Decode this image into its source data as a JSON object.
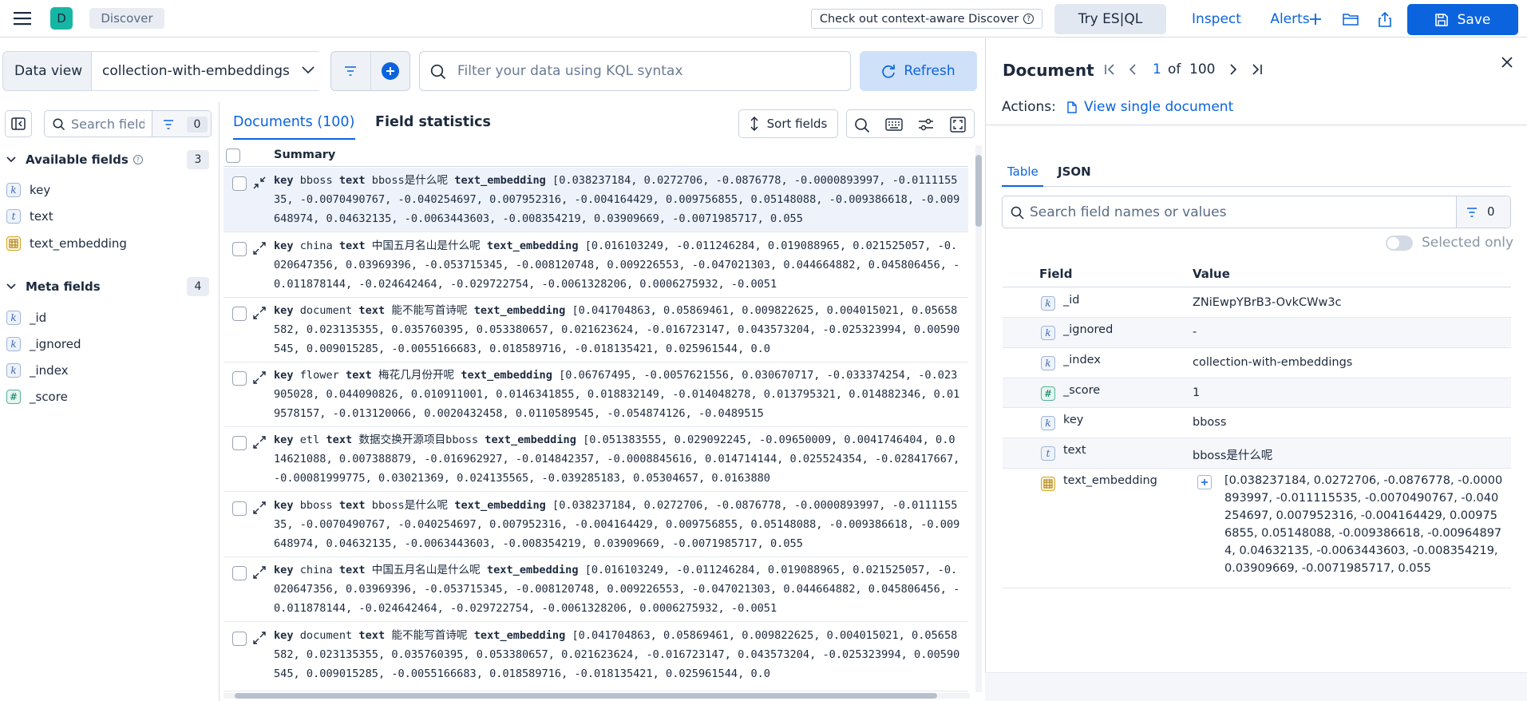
{
  "header": {
    "app_initial": "D",
    "breadcrumb": "Discover",
    "context_aware": "Check out context-aware Discover",
    "try_esql": "Try ES|QL",
    "inspect": "Inspect",
    "alerts": "Alerts",
    "save": "Save"
  },
  "query_bar": {
    "data_view_label": "Data view",
    "data_view_value": "collection-with-embeddings",
    "search_placeholder": "Filter your data using KQL syntax",
    "refresh": "Refresh"
  },
  "sidebar": {
    "search_placeholder": "Search field names",
    "filter_count": "0",
    "available_title": "Available fields",
    "available_count": "3",
    "available_fields": [
      {
        "type": "k",
        "name": "key"
      },
      {
        "type": "t",
        "name": "text"
      },
      {
        "type": "vector",
        "name": "text_embedding"
      }
    ],
    "meta_title": "Meta fields",
    "meta_count": "4",
    "meta_fields": [
      {
        "type": "k",
        "name": "_id"
      },
      {
        "type": "k",
        "name": "_ignored"
      },
      {
        "type": "k",
        "name": "_index"
      },
      {
        "type": "#",
        "name": "_score"
      }
    ]
  },
  "grid": {
    "tab_documents": "Documents (100)",
    "tab_field_stats": "Field statistics",
    "sort_fields": "Sort fields",
    "summary_header": "Summary",
    "rows": [
      {
        "key": "bboss",
        "text": "bboss是什么呢",
        "emb": "[0.038237184, 0.0272706, -0.0876778, -0.0000893997, -0.011115535, -0.0070490767, -0.040254697, 0.007952316, -0.004164429, 0.009756855, 0.05148088, -0.009386618, -0.009648974, 0.04632135, -0.0063443603, -0.008354219, 0.03909669, -0.0071985717, 0.055"
      },
      {
        "key": "china",
        "text": "中国五月名山是什么呢",
        "emb": "[0.016103249, -0.011246284, 0.019088965, 0.021525057, -0.020647356, 0.03969396, -0.053715345, -0.008120748, 0.009226553, -0.047021303, 0.044664882, 0.045806456, -0.011878144, -0.024642464, -0.029722754, -0.0061328206, 0.0006275932, -0.0051"
      },
      {
        "key": "document",
        "text": "能不能写首诗呢",
        "emb": "[0.041704863, 0.05869461, 0.009822625, 0.004015021, 0.05658582, 0.023135355, 0.035760395, 0.053380657, 0.021623624, -0.016723147, 0.043573204, -0.025323994, 0.00590545, 0.009015285, -0.0055166683, 0.018589716, -0.018135421, 0.025961544, 0.0"
      },
      {
        "key": "flower",
        "text": "梅花几月份开呢",
        "emb": "[0.06767495, -0.0057621556, 0.030670717, -0.033374254, -0.023905028, 0.044090826, 0.010911001, 0.0146341855, 0.018832149, -0.014048278, 0.013795321, 0.014882346, 0.019578157, -0.013120066, 0.0020432458, 0.0110589545, -0.054874126, -0.0489515"
      },
      {
        "key": "etl",
        "text": "数据交换开源项目bboss",
        "emb": "[0.051383555, 0.029092245, -0.09650009, 0.0041746404, 0.014621088, 0.007388879, -0.016962927, -0.014842357, -0.0008845616, 0.014714144, 0.025524354, -0.028417667, -0.00081999775, 0.03021369, 0.024135565, -0.039285183, 0.05304657, 0.0163880"
      },
      {
        "key": "bboss",
        "text": "bboss是什么呢",
        "emb": "[0.038237184, 0.0272706, -0.0876778, -0.0000893997, -0.011115535, -0.0070490767, -0.040254697, 0.007952316, -0.004164429, 0.009756855, 0.05148088, -0.009386618, -0.009648974, 0.04632135, -0.0063443603, -0.008354219, 0.03909669, -0.0071985717, 0.055"
      },
      {
        "key": "china",
        "text": "中国五月名山是什么呢",
        "emb": "[0.016103249, -0.011246284, 0.019088965, 0.021525057, -0.020647356, 0.03969396, -0.053715345, -0.008120748, 0.009226553, -0.047021303, 0.044664882, 0.045806456, -0.011878144, -0.024642464, -0.029722754, -0.0061328206, 0.0006275932, -0.0051"
      },
      {
        "key": "document",
        "text": "能不能写首诗呢",
        "emb": "[0.041704863, 0.05869461, 0.009822625, 0.004015021, 0.05658582, 0.023135355, 0.035760395, 0.053380657, 0.021623624, -0.016723147, 0.043573204, -0.025323994, 0.00590545, 0.009015285, -0.0055166683, 0.018589716, -0.018135421, 0.025961544, 0.0"
      }
    ]
  },
  "flyout": {
    "title": "Document",
    "page_current": "1",
    "page_of": "of",
    "page_total": "100",
    "actions_label": "Actions:",
    "view_single": "View single document",
    "tab_table": "Table",
    "tab_json": "JSON",
    "search_placeholder": "Search field names or values",
    "filter_count": "0",
    "selected_only": "Selected only",
    "col_field": "Field",
    "col_value": "Value",
    "rows": [
      {
        "type": "k",
        "field": "_id",
        "value": "ZNiEwpYBrB3-OvkCWw3c"
      },
      {
        "type": "k",
        "field": "_ignored",
        "value": "-"
      },
      {
        "type": "k",
        "field": "_index",
        "value": "collection-with-embeddings"
      },
      {
        "type": "#",
        "field": "_score",
        "value": "1"
      },
      {
        "type": "k",
        "field": "key",
        "value": "bboss"
      },
      {
        "type": "t",
        "field": "text",
        "value": "bboss是什么呢"
      },
      {
        "type": "vector",
        "field": "text_embedding",
        "value": "[0.038237184, 0.0272706, -0.0876778, -0.0000893997, -0.011115535, -0.0070490767, -0.040254697, 0.007952316, -0.004164429, 0.009756855, 0.05148088, -0.009386618, -0.009648974, 0.04632135, -0.0063443603, -0.008354219, 0.03909669, -0.0071985717, 0.055"
      }
    ]
  },
  "colors": {
    "primary": "#0b64dd",
    "save_bg": "#0b64dd",
    "logo_bg": "#16b6a4"
  }
}
